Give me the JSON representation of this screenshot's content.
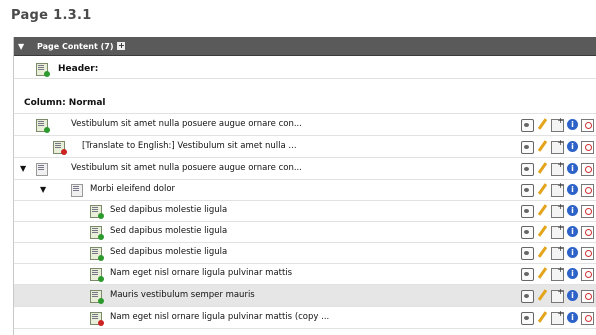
{
  "page": {
    "title": "Page 1.3.1"
  },
  "panel": {
    "title": "Page Content (7)",
    "add_symbol": "+"
  },
  "header_row": {
    "label": "Header:"
  },
  "column": {
    "label": "Column: Normal"
  },
  "rows": [
    {
      "label": "Vestibulum sit amet nulla posuere augue ornare con..."
    },
    {
      "label": "[Translate to English:] Vestibulum sit amet nulla ..."
    },
    {
      "label": "Vestibulum sit amet nulla posuere augue ornare con..."
    },
    {
      "label": "Morbi eleifend dolor"
    },
    {
      "label": "Sed dapibus molestie ligula"
    },
    {
      "label": "Sed dapibus molestie ligula"
    },
    {
      "label": "Sed dapibus molestie ligula"
    },
    {
      "label": "Nam eget nisl ornare ligula pulvinar mattis"
    },
    {
      "label": "Mauris vestibulum semper mauris"
    },
    {
      "label": "Nam eget nisl ornare ligula pulvinar mattis (copy ..."
    }
  ],
  "action_info_glyph": "i",
  "icons": {
    "panel_toggle": "triangle-down",
    "expand": "triangle-down",
    "element": "content-element-icon",
    "actions": [
      "view-icon",
      "edit-pencil-icon",
      "new-record-icon",
      "info-icon",
      "history-icon"
    ]
  }
}
